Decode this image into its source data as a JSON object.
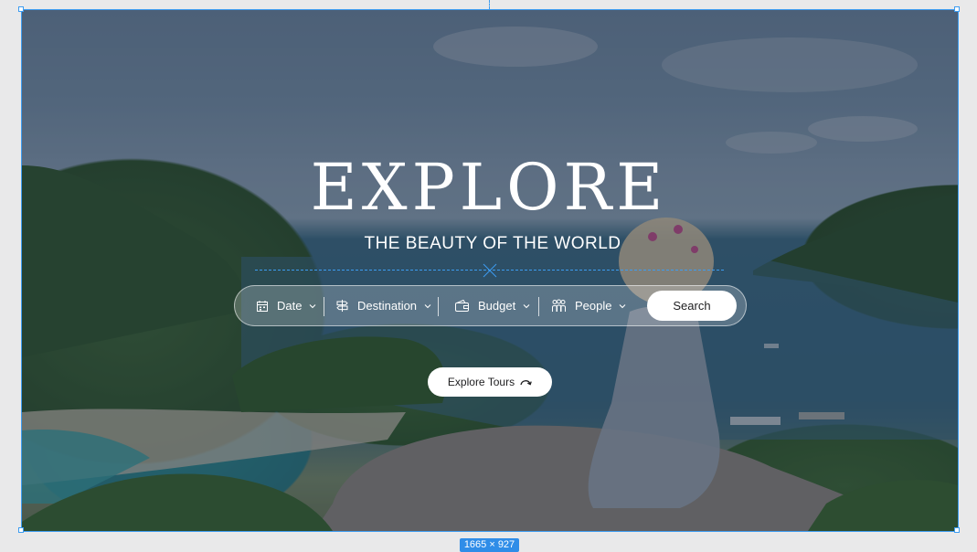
{
  "hero": {
    "title": "EXPLORE",
    "subtitle": "THE BEAUTY OF THE WORLD"
  },
  "search": {
    "fields": [
      {
        "label": "Date",
        "icon": "calendar-icon"
      },
      {
        "label": "Destination",
        "icon": "signpost-icon"
      },
      {
        "label": "Budget",
        "icon": "wallet-icon"
      },
      {
        "label": "People",
        "icon": "people-icon"
      }
    ],
    "button_label": "Search"
  },
  "cta": {
    "label": "Explore Tours",
    "icon": "curved-arrow-icon"
  },
  "editor": {
    "frame_size": "1665 × 927",
    "selection_color": "#3d9cf0"
  },
  "colors": {
    "text": "#ffffff",
    "button_bg": "#ffffff",
    "button_text": "#1d1d1f"
  }
}
